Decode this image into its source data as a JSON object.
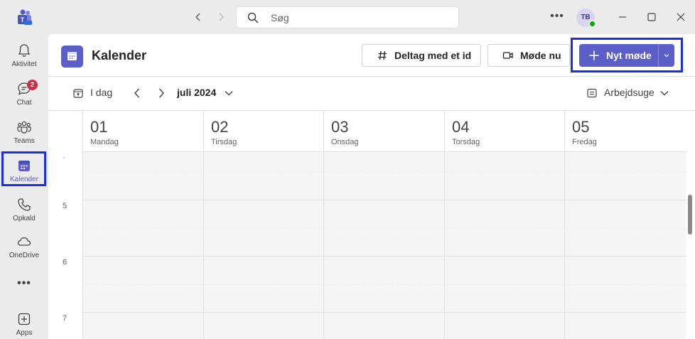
{
  "titlebar": {
    "search_placeholder": "Søg",
    "more_label": "•••",
    "avatar_initials": "TB",
    "presence": "available"
  },
  "rail": {
    "items": [
      {
        "label": "Aktivitet",
        "icon": "bell-icon"
      },
      {
        "label": "Chat",
        "icon": "chat-icon",
        "badge": "2"
      },
      {
        "label": "Teams",
        "icon": "teams-icon"
      },
      {
        "label": "Kalender",
        "icon": "calendar-icon",
        "active": true
      },
      {
        "label": "Opkald",
        "icon": "phone-icon"
      },
      {
        "label": "OneDrive",
        "icon": "cloud-icon"
      },
      {
        "label": "•••",
        "icon": "more-icon"
      },
      {
        "label": "Apps",
        "icon": "apps-icon"
      }
    ]
  },
  "header": {
    "title": "Kalender",
    "join_label": "Deltag med et id",
    "meet_now_label": "Møde nu",
    "new_meeting_label": "Nyt møde"
  },
  "toolbar": {
    "today_label": "I dag",
    "month_label": "juli 2024",
    "view_label": "Arbejdsuge"
  },
  "days": [
    {
      "num": "01",
      "name": "Mandag"
    },
    {
      "num": "02",
      "name": "Tirsdag"
    },
    {
      "num": "03",
      "name": "Onsdag"
    },
    {
      "num": "04",
      "name": "Torsdag"
    },
    {
      "num": "05",
      "name": "Fredag"
    }
  ],
  "hours": [
    "5",
    "6",
    "7"
  ],
  "colors": {
    "accent": "#5b5fc7",
    "highlight": "#1a2ee6",
    "badge": "#c4314b",
    "presence": "#13a10e"
  }
}
